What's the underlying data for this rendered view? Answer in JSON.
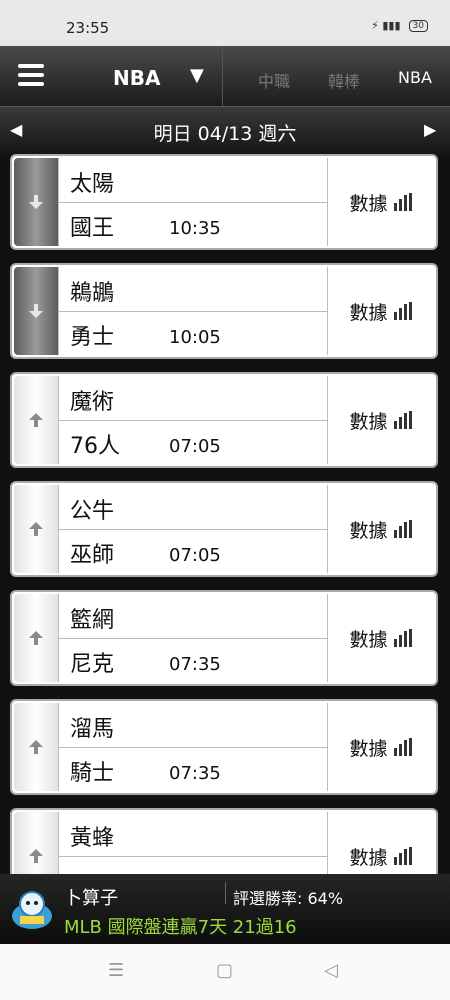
{
  "status_bar": {
    "time": "23:55",
    "battery": "30"
  },
  "nav": {
    "league": "NBA",
    "tabs": [
      "中職",
      "韓棒",
      "NBA"
    ],
    "active_tab": "NBA"
  },
  "date_bar": {
    "date_label": "明日 04/13 週六"
  },
  "games": [
    {
      "team_top": "太陽",
      "team_bottom": "國王",
      "time": "10:35",
      "trend": "down",
      "stats_label": "數據"
    },
    {
      "team_top": "鵜鶘",
      "team_bottom": "勇士",
      "time": "10:05",
      "trend": "down",
      "stats_label": "數據"
    },
    {
      "team_top": "魔術",
      "team_bottom": "76人",
      "time": "07:05",
      "trend": "up",
      "stats_label": "數據"
    },
    {
      "team_top": "公牛",
      "team_bottom": "巫師",
      "time": "07:05",
      "trend": "up",
      "stats_label": "數據"
    },
    {
      "team_top": "籃網",
      "team_bottom": "尼克",
      "time": "07:35",
      "trend": "up",
      "stats_label": "數據"
    },
    {
      "team_top": "溜馬",
      "team_bottom": "騎士",
      "time": "07:35",
      "trend": "up",
      "stats_label": "數據"
    },
    {
      "team_top": "黃蜂",
      "team_bottom": "",
      "time": "",
      "trend": "up",
      "stats_label": "數據"
    }
  ],
  "promo": {
    "brand": "卜算子",
    "win_rate": "評選勝率: 64%",
    "message": "MLB 國際盤連贏7天 21過16"
  },
  "colors": {
    "promo_message": "#9bdc3c",
    "nav_bg": "#1c1c1c",
    "card_border": "#aaaaaa"
  },
  "icons": {
    "menu": "hamburger-menu-icon",
    "league_dropdown": "caret-down-icon",
    "prev_date": "arrow-left-icon",
    "next_date": "arrow-right-icon",
    "trend_down": "arrow-down-icon",
    "trend_up": "arrow-up-icon",
    "stats": "bar-chart-icon"
  }
}
